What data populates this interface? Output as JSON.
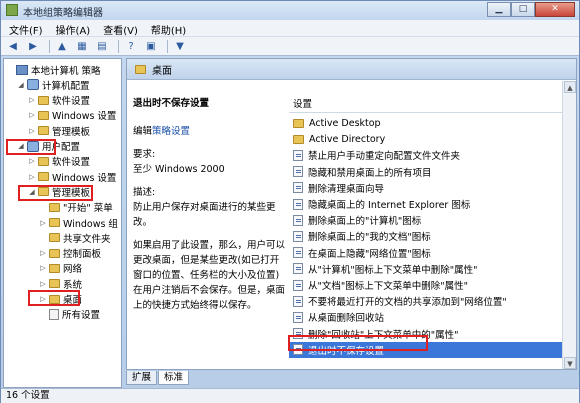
{
  "window": {
    "title": "本地组策略编辑器"
  },
  "menu": [
    "文件(F)",
    "操作(A)",
    "查看(V)",
    "帮助(H)"
  ],
  "tree": [
    {
      "label": "本地计算机 策略",
      "level": 0,
      "icon": "pc",
      "expander": ""
    },
    {
      "label": "计算机配置",
      "level": 1,
      "icon": "config",
      "expander": "◢"
    },
    {
      "label": "软件设置",
      "level": 2,
      "icon": "folder",
      "expander": "▷"
    },
    {
      "label": "Windows 设置",
      "level": 2,
      "icon": "folder",
      "expander": "▷"
    },
    {
      "label": "管理模板",
      "level": 2,
      "icon": "folder",
      "expander": "▷"
    },
    {
      "label": "用户配置",
      "level": 1,
      "icon": "config",
      "expander": "◢"
    },
    {
      "label": "软件设置",
      "level": 2,
      "icon": "folder",
      "expander": "▷"
    },
    {
      "label": "Windows 设置",
      "level": 2,
      "icon": "folder",
      "expander": "▷"
    },
    {
      "label": "管理模板",
      "level": 2,
      "icon": "folder",
      "expander": "◢"
    },
    {
      "label": "\"开始\" 菜单",
      "level": 3,
      "icon": "folder",
      "expander": ""
    },
    {
      "label": "Windows 组",
      "level": 3,
      "icon": "folder",
      "expander": "▷"
    },
    {
      "label": "共享文件夹",
      "level": 3,
      "icon": "folder",
      "expander": ""
    },
    {
      "label": "控制面板",
      "level": 3,
      "icon": "folder",
      "expander": "▷"
    },
    {
      "label": "网络",
      "level": 3,
      "icon": "folder",
      "expander": "▷"
    },
    {
      "label": "系统",
      "level": 3,
      "icon": "folder",
      "expander": "▷"
    },
    {
      "label": "桌面",
      "level": 3,
      "icon": "folder",
      "expander": "▷"
    },
    {
      "label": "所有设置",
      "level": 3,
      "icon": "doc",
      "expander": ""
    }
  ],
  "right_header": {
    "title": "桌面"
  },
  "description": {
    "title": "退出时不保存设置",
    "edit_prefix": "编辑",
    "edit_link": "策略设置",
    "requirements_label": "要求:",
    "requirements_value": "至少 Windows 2000",
    "desc_label": "描述:",
    "desc_text": "防止用户保存对桌面进行的某些更改。",
    "detail_text": "如果启用了此设置，那么，用户可以更改桌面，但是某些更改(如已打开窗口的位置、任务栏的大小及位置)在用户注销后不会保存。但是，桌面上的快捷方式始终得以保存。"
  },
  "list": {
    "header": "设置",
    "items": [
      {
        "label": "Active Desktop",
        "icon": "folder"
      },
      {
        "label": "Active Directory",
        "icon": "folder"
      },
      {
        "label": "禁止用户手动重定向配置文件文件夹",
        "icon": "policy"
      },
      {
        "label": "隐藏和禁用桌面上的所有项目",
        "icon": "policy"
      },
      {
        "label": "删除清理桌面向导",
        "icon": "policy"
      },
      {
        "label": "隐藏桌面上的 Internet Explorer 图标",
        "icon": "policy"
      },
      {
        "label": "删除桌面上的\"计算机\"图标",
        "icon": "policy"
      },
      {
        "label": "删除桌面上的\"我的文档\"图标",
        "icon": "policy"
      },
      {
        "label": "在桌面上隐藏\"网络位置\"图标",
        "icon": "policy"
      },
      {
        "label": "从\"计算机\"图标上下文菜单中删除\"属性\"",
        "icon": "policy"
      },
      {
        "label": "从\"文档\"图标上下文菜单中删除\"属性\"",
        "icon": "policy"
      },
      {
        "label": "不要将最近打开的文档的共享添加到\"网络位置\"",
        "icon": "policy"
      },
      {
        "label": "从桌面删除回收站",
        "icon": "policy"
      },
      {
        "label": "删除\"回收站\"上下文菜单中的\"属性\"",
        "icon": "policy"
      },
      {
        "label": "退出时不保存设置",
        "icon": "policy",
        "selected": true
      }
    ]
  },
  "tabs": [
    "扩展",
    "标准"
  ],
  "status": {
    "text": "16 个设置"
  }
}
